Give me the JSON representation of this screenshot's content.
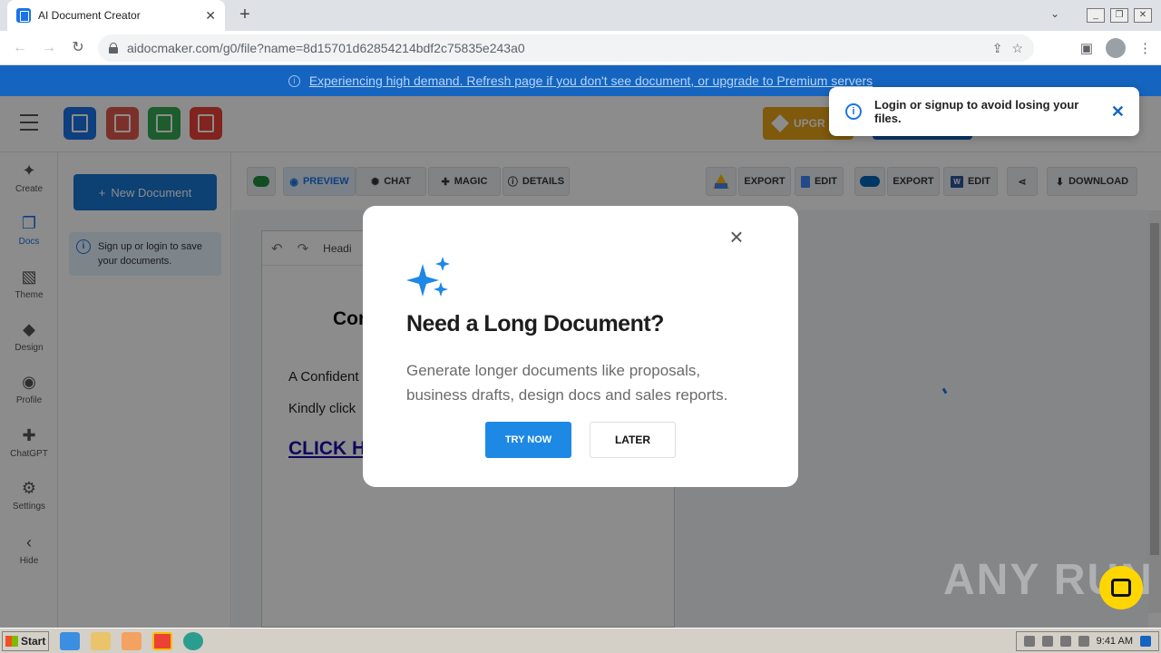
{
  "browser": {
    "tab_title": "AI Document Creator",
    "url": "aidocmaker.com/g0/file?name=8d15701d62854214bdf2c75835e243a0"
  },
  "banner": {
    "text": "Experiencing high demand. Refresh page if you don't see document, or upgrade to Premium servers"
  },
  "header": {
    "upgrade_label": "UPGR",
    "app_tiles": [
      {
        "name": "docs",
        "color": "#1a73e8"
      },
      {
        "name": "slides",
        "color": "#e05a4b"
      },
      {
        "name": "sheets",
        "color": "#34a853"
      },
      {
        "name": "audio",
        "color": "#ea4335"
      }
    ]
  },
  "rail": {
    "items": [
      {
        "label": "Create",
        "icon": "sparkle-icon"
      },
      {
        "label": "Docs",
        "icon": "docs-icon"
      },
      {
        "label": "Theme",
        "icon": "image-icon"
      },
      {
        "label": "Design",
        "icon": "design-icon"
      },
      {
        "label": "Profile",
        "icon": "profile-icon"
      },
      {
        "label": "ChatGPT",
        "icon": "chatgpt-icon"
      },
      {
        "label": "Settings",
        "icon": "gear-icon"
      },
      {
        "label": "Hide",
        "icon": "chevron-left-icon"
      }
    ]
  },
  "sidebar": {
    "new_document": "New Document",
    "signup_note": "Sign up or login to save your documents."
  },
  "doc_toolbar": {
    "preview": "PREVIEW",
    "chat": "CHAT",
    "magic": "MAGIC",
    "details": "DETAILS",
    "export_drive": "EXPORT",
    "edit_drive": "EDIT",
    "export_onedrive": "EXPORT",
    "edit_word": "EDIT",
    "download": "DOWNLOAD"
  },
  "editor": {
    "style_label": "Headi",
    "heading": "Cor",
    "line1": "A Confident",
    "line2": "Kindly click",
    "link": "CLICK H"
  },
  "toast": {
    "message": "Login or signup to avoid losing your files."
  },
  "modal": {
    "title": "Need a Long Document?",
    "description": "Generate longer documents like proposals, business drafts, design docs and sales reports.",
    "primary": "TRY NOW",
    "secondary": "LATER"
  },
  "watermark": "ANY RUN",
  "taskbar": {
    "start": "Start",
    "clock": "9:41 AM"
  }
}
